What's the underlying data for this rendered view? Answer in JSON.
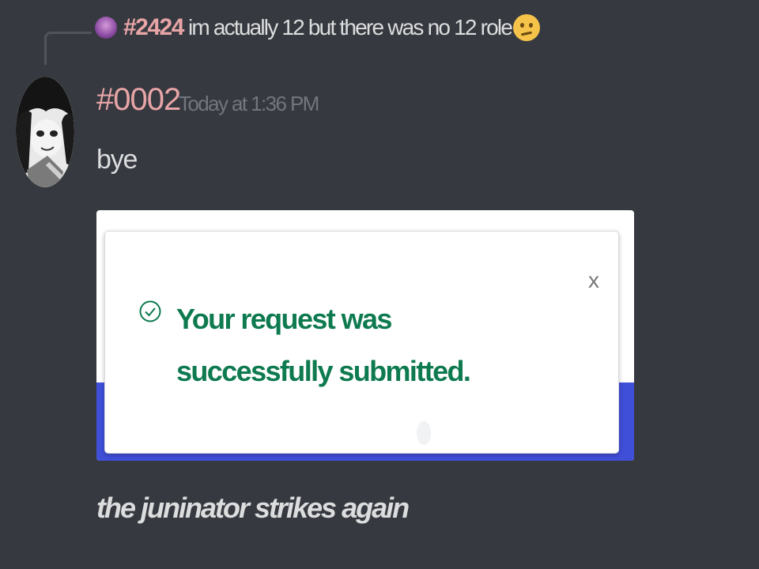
{
  "reply": {
    "username": "#2424",
    "text": "im actually 12 but there was no 12 role",
    "emoji_icon": "confused-face-emoji"
  },
  "message": {
    "username": "#0002",
    "timestamp": "Today at 1:36 PM",
    "text": "bye",
    "username_color": "#e8a5a7"
  },
  "attachment": {
    "toast_message": "Your request was successfully submitted.",
    "close_label": "x",
    "success_color": "#0e7a4f",
    "banner_color": "#3f4fd8"
  },
  "caption": {
    "text": "the juninator strikes again"
  }
}
